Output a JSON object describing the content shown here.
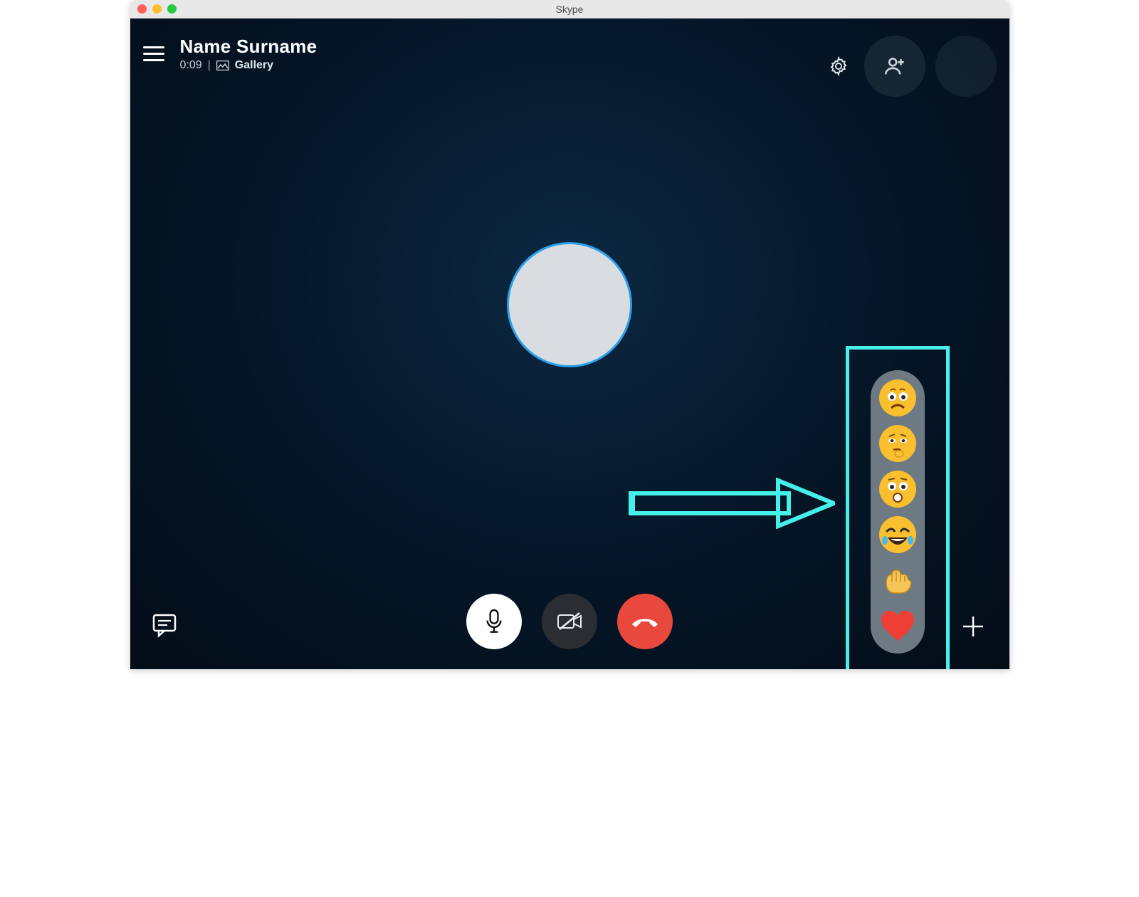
{
  "window": {
    "title": "Skype"
  },
  "header": {
    "callee_name": "Name Surname",
    "duration": "0:09",
    "separator": "|",
    "view_label": "Gallery"
  },
  "controls": {
    "menu": "menu",
    "settings": "settings",
    "add_participant": "add-participant",
    "mic": "microphone",
    "camera_off": "camera-off",
    "end_call": "end-call",
    "chat": "chat",
    "more": "more"
  },
  "reactions": {
    "items": [
      {
        "name": "sad-face",
        "type": "emoji"
      },
      {
        "name": "thinking-face",
        "type": "emoji"
      },
      {
        "name": "surprised-face",
        "type": "emoji"
      },
      {
        "name": "laughing-face",
        "type": "emoji"
      },
      {
        "name": "fist-bump",
        "type": "emoji"
      },
      {
        "name": "heart",
        "type": "emoji"
      }
    ]
  },
  "annotations": {
    "highlight_box": true,
    "arrow": true
  },
  "colors": {
    "highlight": "#45f0e8",
    "end_call": "#e9493c",
    "avatar_ring": "#2aa0e8"
  }
}
